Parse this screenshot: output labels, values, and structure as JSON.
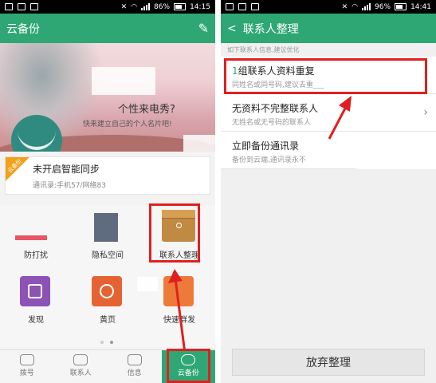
{
  "left": {
    "status": {
      "percent": "86%",
      "time": "14:15"
    },
    "header": {
      "title": "云备份"
    },
    "banner": {
      "text1": "个性来电秀?",
      "text2": "快来建立自己的个人名片吧!"
    },
    "sync_card": {
      "ribbon": "云备份",
      "title": "未开启智能同步",
      "detail": "通讯录:手机57/网络83"
    },
    "grid": [
      {
        "label": "防打扰",
        "icon": "shield-icon"
      },
      {
        "label": "隐私空间",
        "icon": "lock-icon"
      },
      {
        "label": "联系人整理",
        "icon": "envelope-icon"
      },
      {
        "label": "发现",
        "icon": "gift-icon"
      },
      {
        "label": "黄页",
        "icon": "yellow-pages-icon"
      },
      {
        "label": "快速群发",
        "icon": "send-icon"
      }
    ],
    "nav": [
      {
        "label": "拨号",
        "icon": "phone-icon"
      },
      {
        "label": "联系人",
        "icon": "contacts-icon"
      },
      {
        "label": "信息",
        "icon": "message-icon"
      },
      {
        "label": "云备份",
        "icon": "cloud-icon"
      }
    ]
  },
  "right": {
    "status": {
      "percent": "96%",
      "time": "14:41"
    },
    "header": {
      "back": "<",
      "title": "联系人整理"
    },
    "subheader": "如下联系人信息,建议优化",
    "items": [
      {
        "count": "1",
        "title": "组联系人资料重复",
        "desc": "同姓名或同号码,建议去重___"
      },
      {
        "count": "",
        "title": "无资料不完整联系人",
        "desc": "无姓名或无号码的联系人"
      },
      {
        "count": "",
        "title": "立即备份通讯录",
        "desc": "备份到云端,通讯录永不"
      }
    ],
    "button": "放弃整理"
  },
  "colors": {
    "brand": "#2ea774",
    "highlight": "#e02020"
  }
}
